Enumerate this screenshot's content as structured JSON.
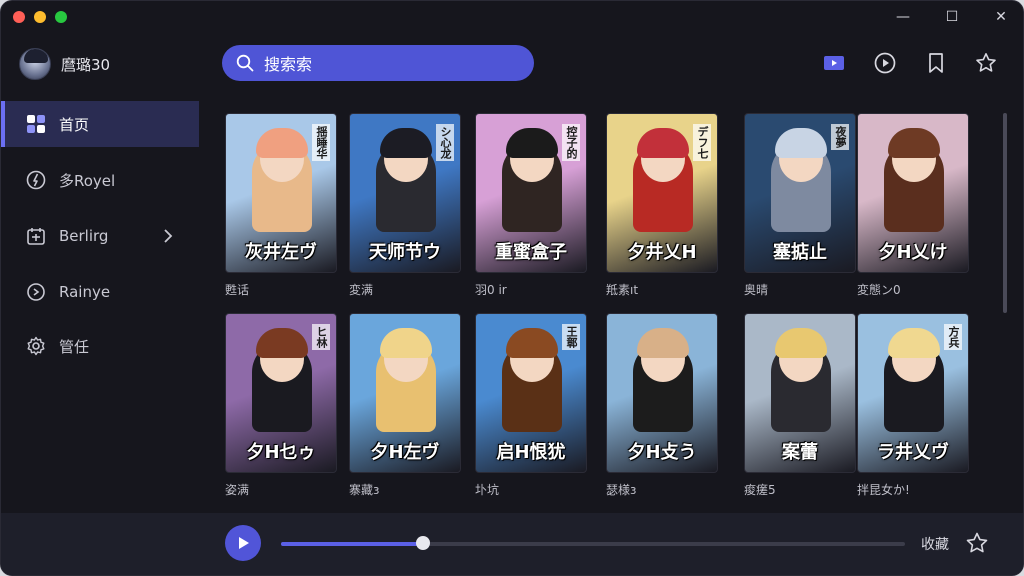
{
  "window": {
    "controls": [
      "close",
      "minimize",
      "maximize"
    ],
    "min_symbol": "—",
    "max_symbol": "☐",
    "close_symbol": "✕"
  },
  "profile": {
    "name": "麿璐30"
  },
  "sidebar": {
    "items": [
      {
        "label": "首页",
        "icon": "grid-icon",
        "active": true
      },
      {
        "label": "多Royel",
        "icon": "compass-icon",
        "active": false
      },
      {
        "label": "Berlirg",
        "icon": "calendar-icon",
        "active": false,
        "has_chevron": true
      },
      {
        "label": "Rainye",
        "icon": "search-circle-icon",
        "active": false
      },
      {
        "label": "管任",
        "icon": "gear-icon",
        "active": false
      }
    ]
  },
  "search": {
    "placeholder": "搜索索"
  },
  "toolbar": {
    "icons": [
      "video-icon",
      "play-circle-icon",
      "bookmark-icon",
      "star-icon"
    ]
  },
  "grid": {
    "rows": [
      [
        {
          "title": "灰井左ヴ",
          "side": "揺睡华",
          "caption": "甦话",
          "palette": [
            "#a9c8e8",
            "#f0a080",
            "#e8b98a"
          ]
        },
        {
          "title": "天师节ウ",
          "side": "シ心龙",
          "caption": "変满",
          "palette": [
            "#3f78c4",
            "#1c1c24",
            "#2a2a30"
          ]
        },
        {
          "title": "重蜜盒子",
          "side": "控子的",
          "caption": "羽0 ir",
          "palette": [
            "#d7a0d6",
            "#1b1b1b",
            "#2f2522"
          ]
        },
        {
          "title": "夕井乂H",
          "side": "デフ七",
          "caption": "羝素ıt",
          "palette": [
            "#e8d38a",
            "#c2303a",
            "#b82a24"
          ]
        },
        {
          "title": "塞掂止",
          "side": "夜夢",
          "caption": "奥晴",
          "palette": [
            "#2a4a70",
            "#c8d4e4",
            "#7e8aa0"
          ]
        },
        {
          "title": "夕H乂け",
          "side": "",
          "caption": "変態ン0",
          "palette": [
            "#d8b8c8",
            "#6e3a24",
            "#5a2e1e"
          ]
        }
      ],
      [
        {
          "title": "夕H乜ゥ",
          "side": "ヒ林",
          "caption": "姿满",
          "palette": [
            "#8e6aa8",
            "#7a3a22",
            "#1a1a20"
          ]
        },
        {
          "title": "夕H左ヴ",
          "side": "",
          "caption": "寨藏ɜ",
          "palette": [
            "#6aa6dc",
            "#f0d48a",
            "#e8c070"
          ]
        },
        {
          "title": "启H恨犹",
          "side": "王鄣",
          "caption": "圤坑",
          "palette": [
            "#4a8ad0",
            "#8a4a22",
            "#5a3016"
          ]
        },
        {
          "title": "夕H攴う",
          "side": "",
          "caption": "瑟様ɜ",
          "palette": [
            "#8ab4d8",
            "#d8b088",
            "#1c1c1c"
          ]
        },
        {
          "title": "案蕾",
          "side": "",
          "caption": "痠瘥5",
          "palette": [
            "#aab8c8",
            "#e8c870",
            "#2a2a30"
          ]
        },
        {
          "title": "ラ井乂ヴ",
          "side": "方兵",
          "caption": "拌昆女か!",
          "palette": [
            "#9ac0e0",
            "#f0d890",
            "#1a1a20"
          ]
        }
      ]
    ]
  },
  "player": {
    "progress": 0.228,
    "favorite_label": "收藏"
  },
  "colors": {
    "accent": "#5155d8",
    "background": "#16161d",
    "active_nav": "#2a2c52"
  }
}
